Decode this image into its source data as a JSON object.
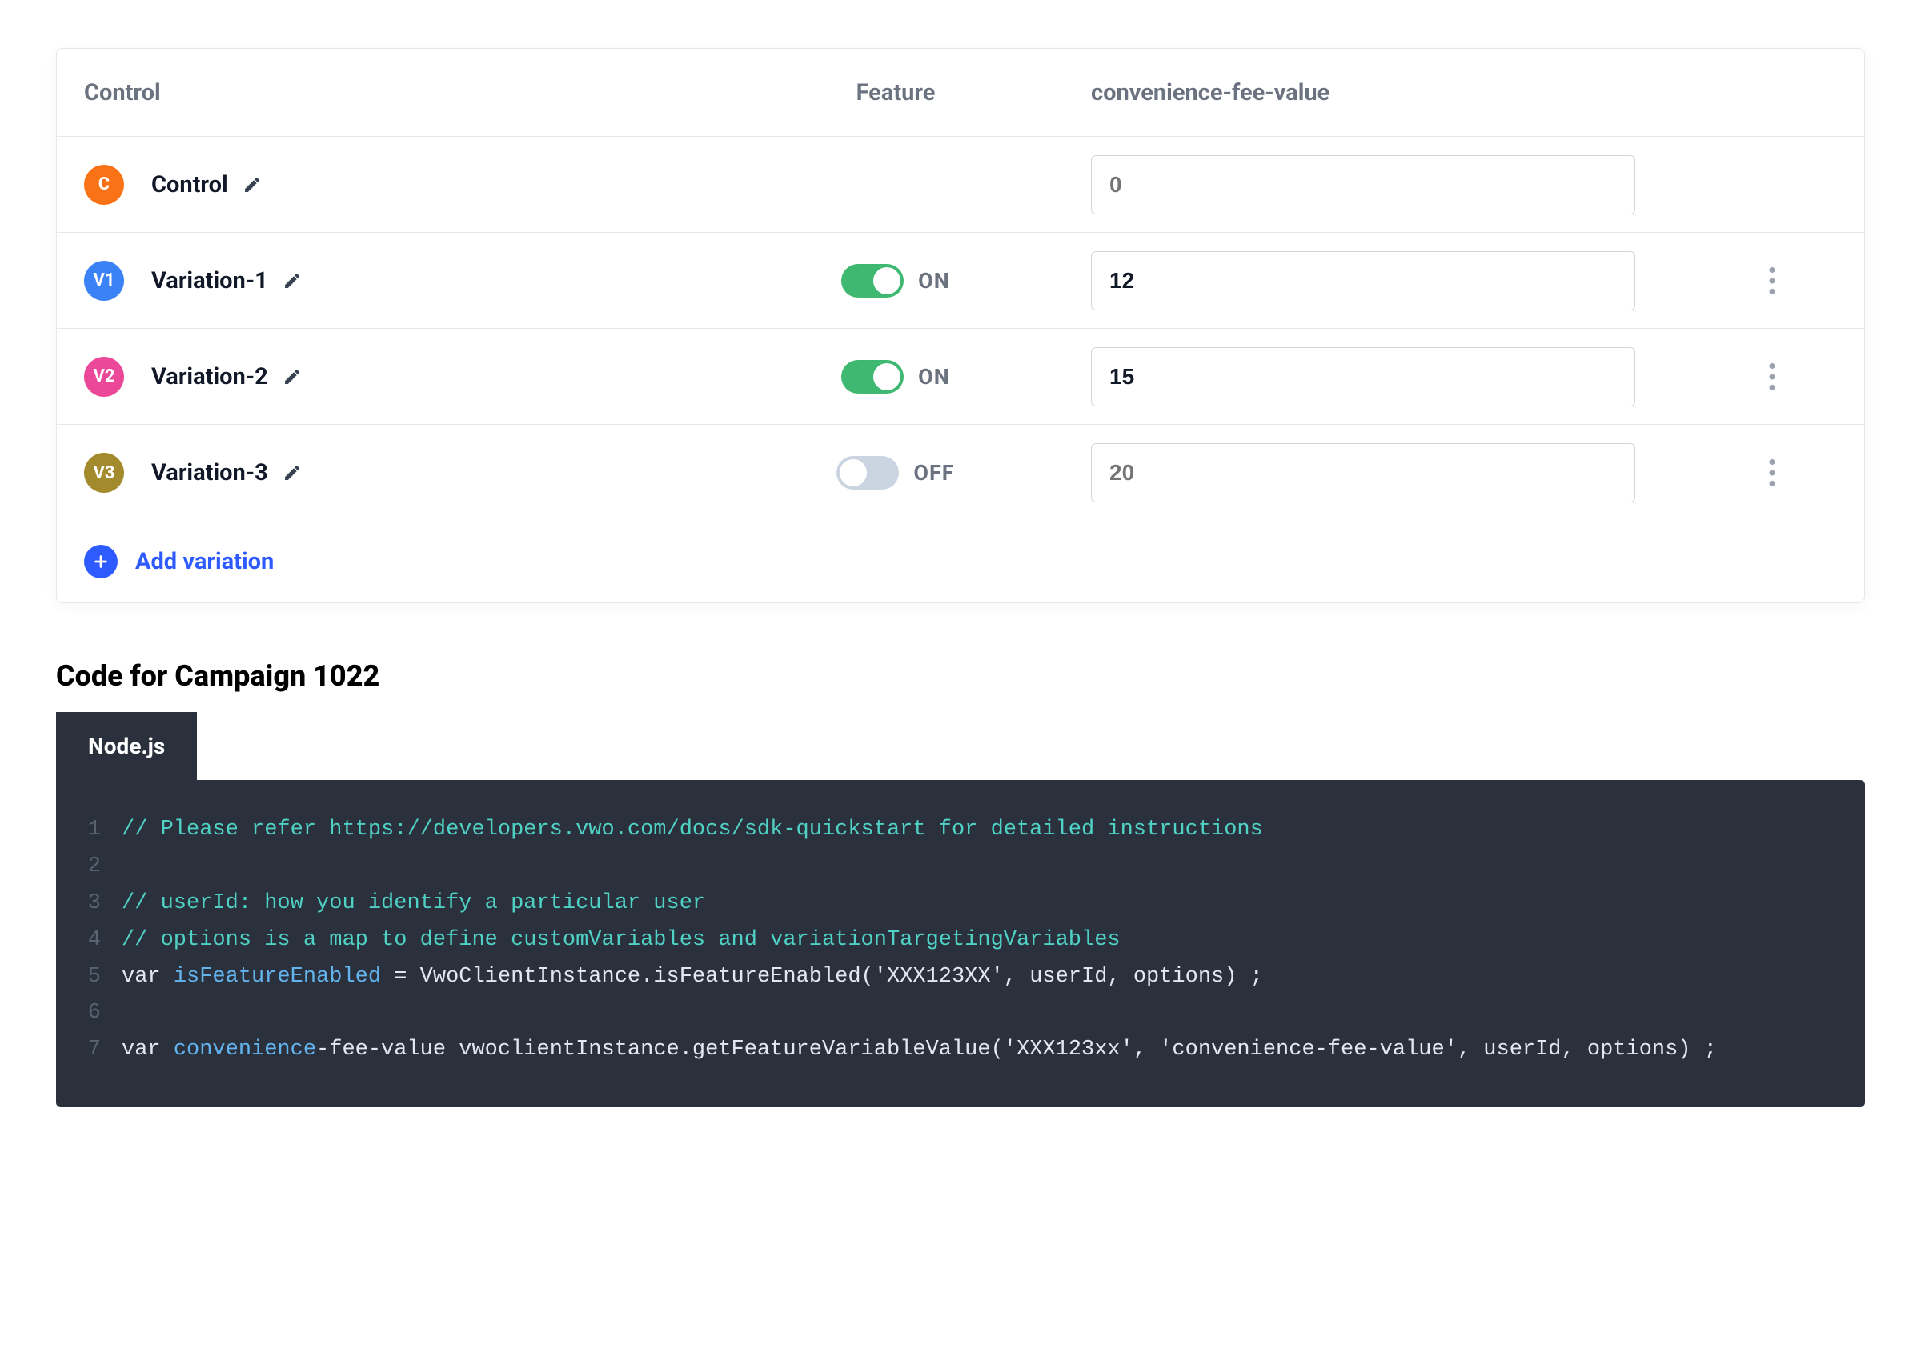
{
  "table": {
    "headers": {
      "control": "Control",
      "feature": "Feature",
      "variable": "convenience-fee-value"
    },
    "rows": [
      {
        "badge": "C",
        "badgeColor": "#f97316",
        "name": "Control",
        "hasToggle": false,
        "toggleOn": false,
        "toggleLabel": "",
        "value": "0",
        "valueDisabled": true,
        "hasMenu": false
      },
      {
        "badge": "V1",
        "badgeColor": "#3b82f6",
        "name": "Variation-1",
        "hasToggle": true,
        "toggleOn": true,
        "toggleLabel": "ON",
        "value": "12",
        "valueDisabled": false,
        "hasMenu": true
      },
      {
        "badge": "V2",
        "badgeColor": "#ec4899",
        "name": "Variation-2",
        "hasToggle": true,
        "toggleOn": true,
        "toggleLabel": "ON",
        "value": "15",
        "valueDisabled": false,
        "hasMenu": true
      },
      {
        "badge": "V3",
        "badgeColor": "#a38b2d",
        "name": "Variation-3",
        "hasToggle": true,
        "toggleOn": false,
        "toggleLabel": "OFF",
        "value": "20",
        "valueDisabled": true,
        "hasMenu": true
      }
    ],
    "addLabel": "Add variation"
  },
  "codeSection": {
    "title": "Code for Campaign 1022",
    "tab": "Node.js",
    "lines": [
      {
        "n": "1",
        "segments": [
          {
            "cls": "tok-comment",
            "text": "// Please refer https://developers.vwo.com/docs/sdk-quickstart for detailed instructions"
          }
        ]
      },
      {
        "n": "2",
        "segments": []
      },
      {
        "n": "3",
        "segments": [
          {
            "cls": "tok-comment",
            "text": "// userId: how you identify a particular user"
          }
        ]
      },
      {
        "n": "4",
        "segments": [
          {
            "cls": "tok-comment",
            "text": "// options is a map to define customVariables and variationTargetingVariables"
          }
        ]
      },
      {
        "n": "5",
        "segments": [
          {
            "cls": "tok-kw",
            "text": "var "
          },
          {
            "cls": "tok-ident",
            "text": "isFeatureEnabled"
          },
          {
            "cls": "tok-kw",
            "text": " = VwoClientInstance.isFeatureEnabled('XXX123XX', userId, options) ;"
          }
        ]
      },
      {
        "n": "6",
        "segments": []
      },
      {
        "n": "7",
        "segments": [
          {
            "cls": "tok-kw",
            "text": "var "
          },
          {
            "cls": "tok-ident",
            "text": "convenience"
          },
          {
            "cls": "tok-kw",
            "text": "-fee-value vwoclientInstance.getFeatureVariableValue('XXX123xx', 'convenience-fee-value', userId, options) ;"
          }
        ]
      }
    ]
  }
}
